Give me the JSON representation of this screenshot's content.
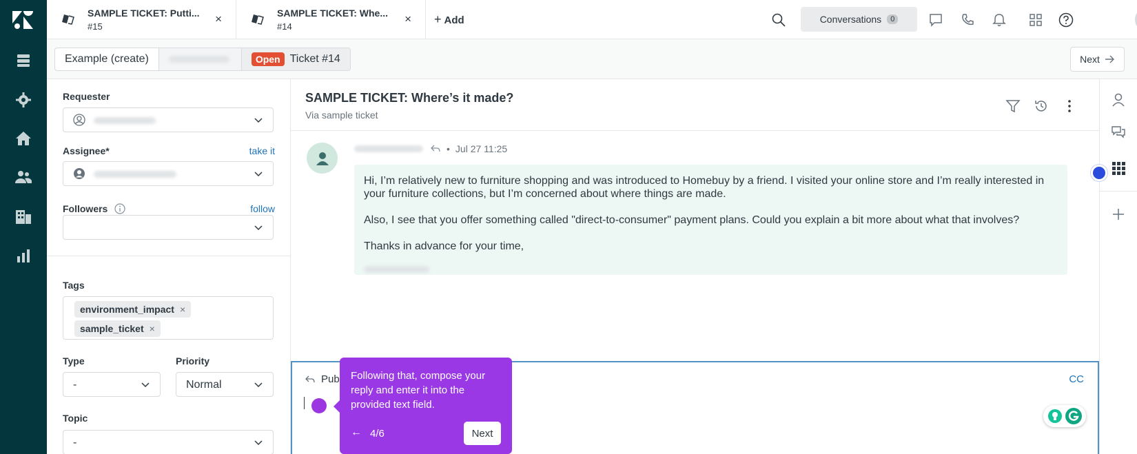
{
  "tabs": [
    {
      "title": "SAMPLE TICKET: Putti...",
      "number": "#15",
      "close": "×"
    },
    {
      "title": "SAMPLE TICKET: Whe...",
      "number": "#14",
      "close": "×"
    }
  ],
  "topbar": {
    "add_label": "Add",
    "conversations_label": "Conversations",
    "conversations_count": "0"
  },
  "breadcrumb": {
    "item1": "Example (create)",
    "status": "Open",
    "ticket": "Ticket #14"
  },
  "header": {
    "next_label": "Next"
  },
  "properties": {
    "requester_label": "Requester",
    "assignee_label": "Assignee*",
    "take_it_link": "take it",
    "followers_label": "Followers",
    "follow_link": "follow",
    "tags_label": "Tags",
    "tags": [
      "environment_impact",
      "sample_ticket"
    ],
    "type_label": "Type",
    "type_value": "-",
    "priority_label": "Priority",
    "priority_value": "Normal",
    "topic_label": "Topic",
    "topic_value": "-"
  },
  "ticket": {
    "title": "SAMPLE TICKET: Where’s it made?",
    "via": "Via sample ticket",
    "message_time": "Jul 27 11:25",
    "message_paragraphs": [
      "Hi, I’m relatively new to furniture shopping and was introduced to Homebuy by a friend. I visited your online store and I’m really interested in your furniture collections, but I’m concerned about where things are made.",
      "Also, I see that you offer something called \"direct-to-consumer\" payment plans. Could you explain a bit more about what that involves?",
      "Thanks in advance for your time,"
    ]
  },
  "composer": {
    "reply_mode": "Pub",
    "cc_label": "CC"
  },
  "tooltip": {
    "text": "Following that, compose your reply and enter it into the provided text field.",
    "back": "←",
    "step": "4/6",
    "next": "Next"
  },
  "colors": {
    "nav_bg": "#03363d",
    "accent_link": "#1f73b7",
    "open_badge": "#e34f32",
    "tooltip_bg": "#9a38e5",
    "bubble_bg": "#edf8f4"
  }
}
